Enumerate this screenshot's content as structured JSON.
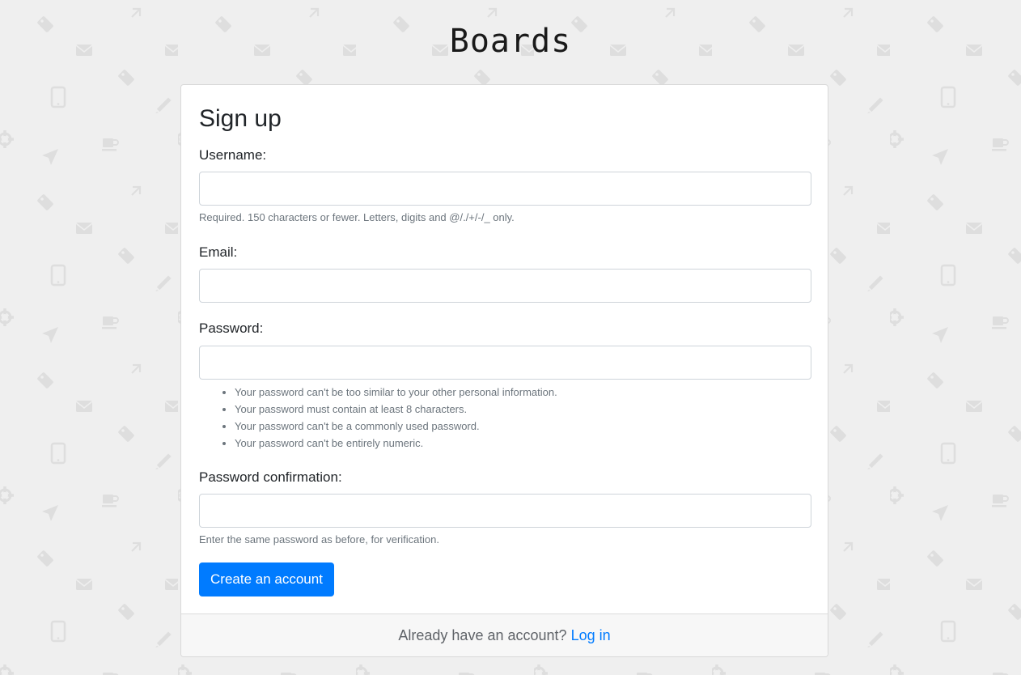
{
  "brand": "Boards",
  "signup": {
    "title": "Sign up",
    "fields": {
      "username": {
        "label": "Username:",
        "value": "",
        "help": "Required. 150 characters or fewer. Letters, digits and @/./+/-/_ only."
      },
      "email": {
        "label": "Email:",
        "value": ""
      },
      "password": {
        "label": "Password:",
        "value": "",
        "help_items": [
          "Your password can't be too similar to your other personal information.",
          "Your password must contain at least 8 characters.",
          "Your password can't be a commonly used password.",
          "Your password can't be entirely numeric."
        ]
      },
      "password_confirmation": {
        "label": "Password confirmation:",
        "value": "",
        "help": "Enter the same password as before, for verification."
      }
    },
    "submit_label": "Create an account",
    "footer": {
      "text": "Already have an account?",
      "link_label": "Log in"
    }
  },
  "colors": {
    "background": "#efefef",
    "pattern_icon": "#dedede",
    "primary": "#007bff"
  },
  "background_icons": [
    "tag-icon",
    "mail-icon",
    "tablet-icon",
    "pencil-icon",
    "coffee-icon",
    "send-icon",
    "expand-icon",
    "gear-icon"
  ]
}
